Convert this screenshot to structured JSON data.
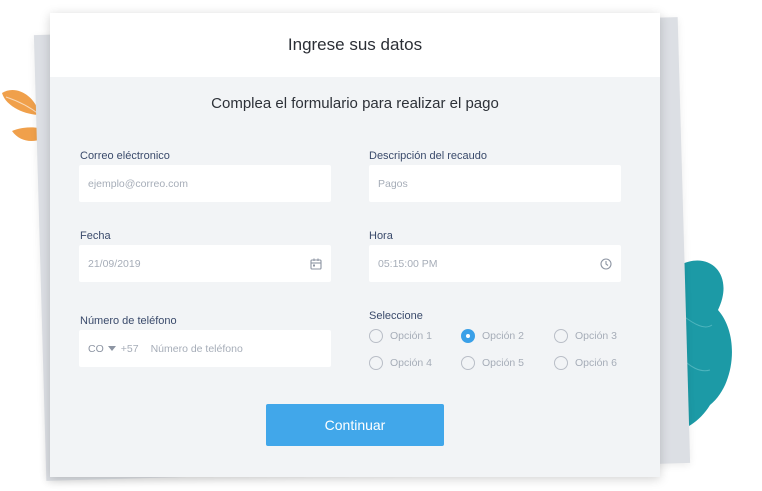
{
  "header": {
    "title": "Ingrese sus datos"
  },
  "subtitle": "Complea el formulario para realizar el pago",
  "fields": {
    "email": {
      "label": "Correo eléctronico",
      "placeholder": "ejemplo@correo.com"
    },
    "description": {
      "label": "Descripción del recaudo",
      "placeholder": "Pagos"
    },
    "date": {
      "label": "Fecha",
      "value": "21/09/2019",
      "icon": "calendar-icon"
    },
    "time": {
      "label": "Hora",
      "value": "05:15:00 PM",
      "icon": "clock-icon"
    },
    "phone": {
      "label": "Número de teléfono",
      "country": "CO",
      "code": "+57",
      "placeholder": "Número de teléfono"
    }
  },
  "selection": {
    "label": "Seleccione",
    "options": [
      "Opción 1",
      "Opción 2",
      "Opción 3",
      "Opción 4",
      "Opción 5",
      "Opción 6"
    ],
    "selected": "Opción 2"
  },
  "submit": {
    "label": "Continuar"
  },
  "colors": {
    "accent": "#41a7ea",
    "card_bg": "#f2f4f6",
    "leaf_orange": "#f0a04b",
    "leaf_teal": "#1c9aa6"
  }
}
